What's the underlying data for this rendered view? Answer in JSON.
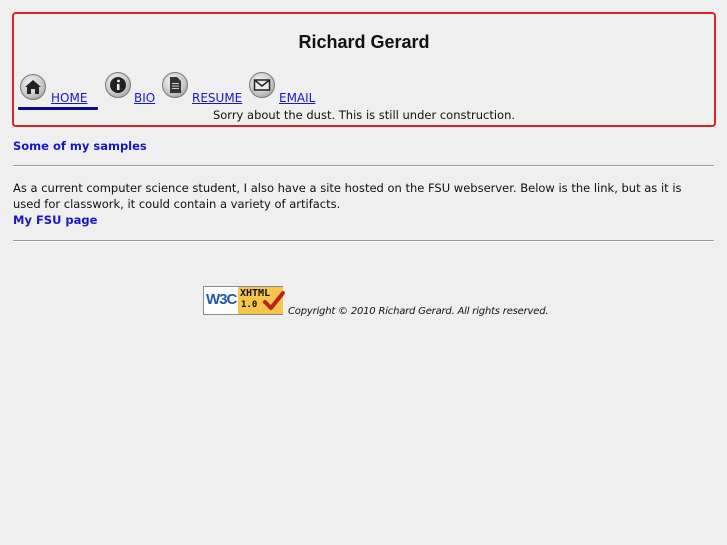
{
  "site": {
    "title": "Richard Gerard"
  },
  "nav": {
    "items": [
      {
        "label": "HOME",
        "icon": "home-icon",
        "active": true
      },
      {
        "label": "BIO",
        "icon": "info-icon",
        "active": false
      },
      {
        "label": "RESUME",
        "icon": "document-icon",
        "active": false
      },
      {
        "label": "EMAIL",
        "icon": "envelope-icon",
        "active": false
      }
    ]
  },
  "notice": "Sorry about the dust. This is still under construction.",
  "main": {
    "samples_link": "Some of my samples",
    "intro": "As a current computer science student, I also have a site hosted on the FSU webserver. Below is the link, but as it is used for classwork, it could contain a variety of artifacts.",
    "fsu_link": "My FSU page"
  },
  "footer": {
    "badge": {
      "org": "W3C",
      "standard": "XHTML",
      "version": "1.0"
    },
    "copyright": "Copyright © 2010 Richard Gerard. All rights reserved."
  },
  "colors": {
    "link": "#1a16c8",
    "header_border": "#d8202a",
    "active_underline": "#0a0a8a",
    "background": "#efefef"
  }
}
